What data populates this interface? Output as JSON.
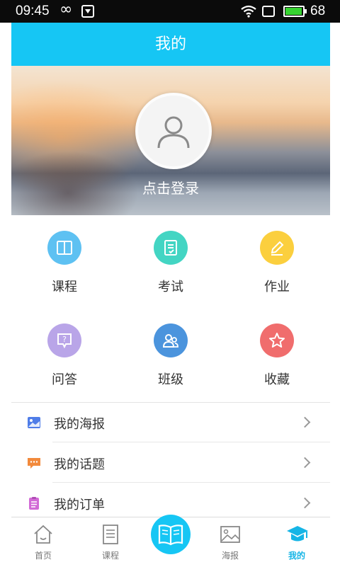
{
  "status_bar": {
    "time": "09:45",
    "infinity": "∞",
    "battery_level": "68"
  },
  "header": {
    "title": "我的"
  },
  "profile": {
    "login_label": "点击登录"
  },
  "feature_grid": [
    {
      "label": "课程",
      "icon": "book-icon",
      "color": "#5ec1f2"
    },
    {
      "label": "考试",
      "icon": "exam-paper-icon",
      "color": "#43d5c3"
    },
    {
      "label": "作业",
      "icon": "pencil-icon",
      "color": "#fbcf3e"
    },
    {
      "label": "问答",
      "icon": "question-bubble-icon",
      "color": "#b9a5e8"
    },
    {
      "label": "班级",
      "icon": "class-users-icon",
      "color": "#4b94dd"
    },
    {
      "label": "收藏",
      "icon": "star-icon",
      "color": "#f06d6d"
    }
  ],
  "menu_list": [
    {
      "label": "我的海报",
      "icon": "poster-icon",
      "color": "#4f7de8"
    },
    {
      "label": "我的话题",
      "icon": "topic-chat-icon",
      "color": "#f28a3c"
    },
    {
      "label": "我的订单",
      "icon": "order-clipboard-icon",
      "color": "#d26ad6"
    }
  ],
  "tab_bar": {
    "tabs": [
      {
        "label": "首页",
        "icon": "home-icon"
      },
      {
        "label": "课程",
        "icon": "course-list-icon"
      },
      {
        "label": "",
        "icon": "center-book-icon"
      },
      {
        "label": "海报",
        "icon": "poster-image-icon"
      },
      {
        "label": "我的",
        "icon": "graduation-cap-icon",
        "active": true
      }
    ],
    "accent_color": "#16c6f4"
  }
}
